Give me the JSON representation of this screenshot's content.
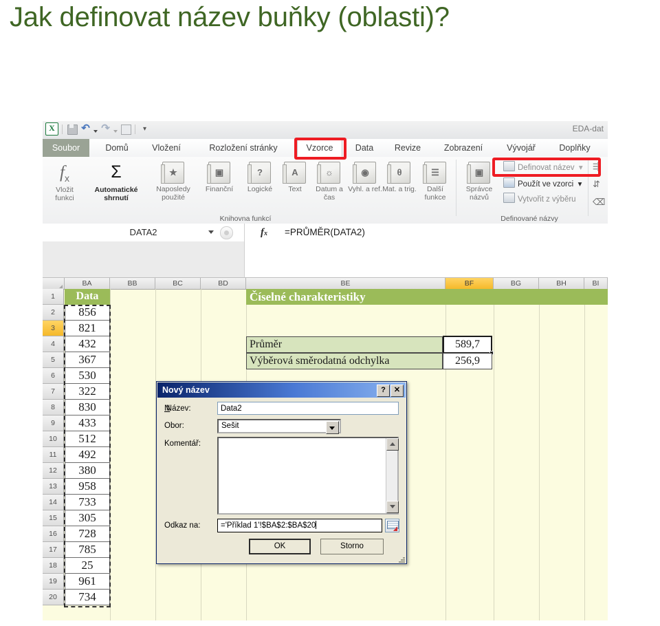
{
  "slide": {
    "title": "Jak definovat název buňky (oblasti)?",
    "title_color": "#3f6624"
  },
  "excel": {
    "app_title": "EDA-dat",
    "quick_access": [
      {
        "name": "excel-logo",
        "glyph": "X"
      },
      {
        "name": "save-icon",
        "glyph": ""
      },
      {
        "name": "undo-icon",
        "glyph": "↶"
      },
      {
        "name": "redo-icon",
        "glyph": "↷"
      },
      {
        "name": "custom-icon",
        "glyph": ""
      },
      {
        "name": "customize-qat-icon",
        "glyph": "▾"
      }
    ],
    "tabs": [
      {
        "label": "Soubor",
        "state": "file"
      },
      {
        "label": "Domů",
        "state": "normal"
      },
      {
        "label": "Vložení",
        "state": "normal"
      },
      {
        "label": "Rozložení stránky",
        "state": "normal"
      },
      {
        "label": "Vzorce",
        "state": "active"
      },
      {
        "label": "Data",
        "state": "normal"
      },
      {
        "label": "Revize",
        "state": "normal"
      },
      {
        "label": "Zobrazení",
        "state": "normal"
      },
      {
        "label": "Vývojář",
        "state": "normal"
      },
      {
        "label": "Doplňky",
        "state": "normal"
      }
    ],
    "ribbon": {
      "groups": [
        {
          "label": "Knihovna funkcí"
        },
        {
          "label": "Definované názvy"
        }
      ],
      "function_library": [
        {
          "label": "Vložit funkci",
          "icon": "fx-icon"
        },
        {
          "label": "Automatické shrnutí",
          "icon": "sigma-icon",
          "dropdown": true
        },
        {
          "label": "Naposledy použité",
          "icon": "book-icon",
          "dropdown": true
        },
        {
          "label": "Finanční",
          "icon": "book-icon",
          "dropdown": true
        },
        {
          "label": "Logické",
          "icon": "book-question-icon",
          "dropdown": true
        },
        {
          "label": "Text",
          "icon": "book-a-icon",
          "dropdown": true
        },
        {
          "label": "Datum a čas",
          "icon": "book-icon",
          "dropdown": true
        },
        {
          "label": "Vyhl. a ref.",
          "icon": "book-icon",
          "dropdown": true
        },
        {
          "label": "Mat. a trig.",
          "icon": "book-theta-icon",
          "dropdown": true
        },
        {
          "label": "Další funkce",
          "icon": "book-stack-icon",
          "dropdown": true
        }
      ],
      "defined_names": {
        "manager_label": "Správce názvů",
        "manager_icon": "name-manager-icon",
        "items": [
          {
            "label": "Definovat název",
            "icon": "define-name-icon",
            "dropdown": true,
            "highlighted": true
          },
          {
            "label": "Použít ve vzorci",
            "icon": "use-in-formula-icon",
            "dropdown": true
          },
          {
            "label": "Vytvořit z výběru",
            "icon": "create-from-selection-icon",
            "dropdown": false
          }
        ]
      },
      "auditing_icons": [
        "trace-precedents-icon",
        "trace-dependents-icon",
        "remove-arrows-icon"
      ],
      "highlight_color": "#ee1c23"
    },
    "formula_bar": {
      "name_box": "DATA2",
      "fx_label": "fx",
      "formula": "=PRŮMĚR(DATA2)"
    },
    "sheet": {
      "columns": [
        {
          "label": "BA",
          "selected": false
        },
        {
          "label": "BB",
          "selected": false
        },
        {
          "label": "BC",
          "selected": false
        },
        {
          "label": "BD",
          "selected": false
        },
        {
          "label": "BE",
          "selected": false
        },
        {
          "label": "BF",
          "selected": true
        },
        {
          "label": "BG",
          "selected": false
        },
        {
          "label": "BH",
          "selected": false
        },
        {
          "label": "BI",
          "selected": false
        }
      ],
      "rows": [
        "1",
        "2",
        "3",
        "4",
        "5",
        "6",
        "7",
        "8",
        "9",
        "10",
        "11",
        "12",
        "13",
        "14",
        "15",
        "16",
        "17",
        "18",
        "19",
        "20"
      ],
      "active_row": "3",
      "data_header": "Data",
      "data_values": [
        "856",
        "821",
        "432",
        "367",
        "530",
        "322",
        "830",
        "433",
        "512",
        "492",
        "380",
        "958",
        "733",
        "305",
        "728",
        "785",
        "25",
        "961",
        "734"
      ],
      "banner_title": "Číselné charakteristiky",
      "stats": [
        {
          "label": "Průměr",
          "value": "589,7",
          "active": true
        },
        {
          "label": "Výběrová směrodatná odchylka",
          "value": "256,9",
          "active": false
        }
      ],
      "background_color": "#fcfce0",
      "accent_color": "#9bbb59",
      "stat_label_color": "#d7e4bd"
    }
  },
  "dialog": {
    "title": "Nový název",
    "help_button": "?",
    "close_button": "✕",
    "fields": [
      {
        "label": "Název:",
        "value": "Data2",
        "type": "text"
      },
      {
        "label": "Obor:",
        "value": "Sešit",
        "type": "combo"
      },
      {
        "label": "Komentář:",
        "value": "",
        "type": "textarea"
      },
      {
        "label": "Odkaz na:",
        "value": "='Příklad 1'!$BA$2:$BA$20",
        "type": "reference"
      }
    ],
    "buttons": [
      {
        "label": "OK",
        "default": true
      },
      {
        "label": "Storno",
        "default": false
      }
    ]
  }
}
